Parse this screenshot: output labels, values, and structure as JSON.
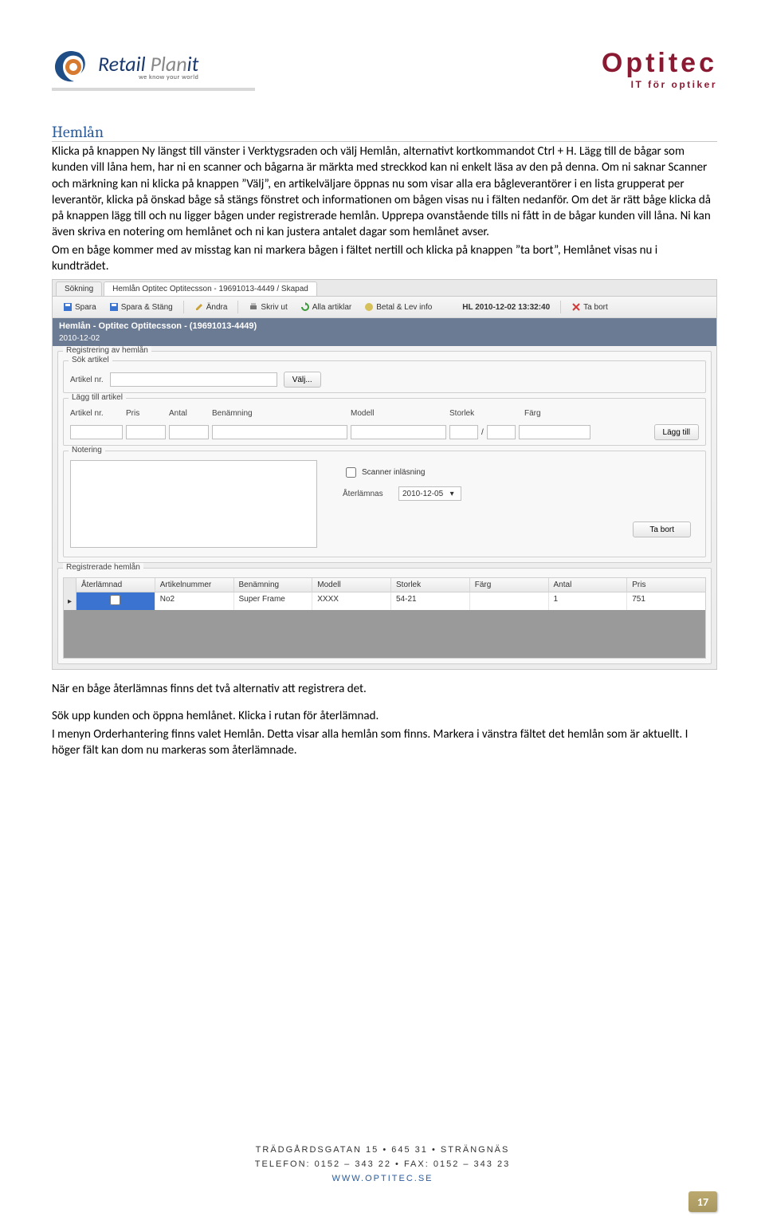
{
  "header": {
    "logo_brand_a": "Retail",
    "logo_brand_b": " Plan",
    "logo_brand_c": "it",
    "logo_tag": "we know your world",
    "brand_name": "Optitec",
    "brand_sub": "IT för optiker"
  },
  "section_title": "Hemlån",
  "body_text_1": "Klicka på knappen Ny längst till vänster i Verktygsraden och välj Hemlån, alternativt kortkommandot Ctrl + H. Lägg till de bågar som kunden vill låna hem, har ni en scanner och bågarna är märkta med streckkod kan ni enkelt läsa av den på denna. Om ni saknar Scanner och märkning kan ni klicka på knappen ”Välj”, en artikelväljare öppnas nu som visar alla era bågleverantörer i en lista grupperat per leverantör, klicka på önskad båge så stängs fönstret och informationen om bågen visas nu i fälten nedanför. Om det är rätt båge klicka då på knappen lägg till och nu ligger bågen under registrerade hemlån. Upprepa ovanstående tills ni fått in de bågar kunden vill låna. Ni kan även skriva en notering om hemlånet och ni kan justera antalet dagar som hemlånet avser.",
  "body_text_2": "Om en båge kommer med av misstag kan ni markera bågen i fältet nertill och klicka på knappen ”ta bort”, Hemlånet visas nu i kundträdet.",
  "body_text_3": "När en båge återlämnas finns det två alternativ att registrera det.",
  "body_text_4": "Sök upp kunden och öppna hemlånet. Klicka i rutan för återlämnad.",
  "body_text_5": "I menyn Orderhantering finns valet Hemlån. Detta visar alla hemlån som finns. Markera i vänstra fältet det hemlån som är aktuellt. I höger fält kan dom nu markeras som återlämnade.",
  "app": {
    "tabs": [
      "Sökning",
      "Hemlån Optitec Optitecsson - 19691013-4449 / Skapad"
    ],
    "toolbar": {
      "spara": "Spara",
      "spara_stang": "Spara & Stäng",
      "andra": "Ändra",
      "skriv_ut": "Skriv ut",
      "alla_artiklar": "Alla artiklar",
      "betal": "Betal & Lev info",
      "hl": "HL 2010-12-02 13:32:40",
      "ta_bort": "Ta bort"
    },
    "titlebar": "Hemlån - Optitec Optitecsson - (19691013-4449)",
    "date": "2010-12-02",
    "reg_label": "Registrering av hemlån",
    "sok_label": "Sök artikel",
    "artnr_label": "Artikel nr.",
    "valj_btn": "Välj...",
    "lagg_label": "Lägg till artikel",
    "lagg_headers": [
      "Artikel nr.",
      "Pris",
      "Antal",
      "Benämning",
      "Modell",
      "Storlek",
      "Färg"
    ],
    "lagg_btn": "Lägg till",
    "notering_label": "Notering",
    "scanner_label": "Scanner inläsning",
    "ater_label": "Återlämnas",
    "ater_value": "2010-12-05",
    "tabort_btn": "Ta bort",
    "reg_hemlan_label": "Registrerade hemlån",
    "table_headers": [
      "Återlämnad",
      "Artikelnummer",
      "Benämning",
      "Modell",
      "Storlek",
      "Färg",
      "Antal",
      "Pris"
    ],
    "table_row": {
      "aterlamnad": "",
      "artnr": "No2",
      "benamning": "Super Frame",
      "modell": "XXXX",
      "storlek": "54-21",
      "farg": "",
      "antal": "1",
      "pris": "751"
    }
  },
  "footer": {
    "addr": "TRÄDGÅRDSGATAN 15 • 645 31 • STRÄNGNÄS",
    "tel": "TELEFON: 0152 – 343 22 • FAX: 0152 – 343 23",
    "url": "WWW.OPTITEC.SE"
  },
  "page_number": "17"
}
